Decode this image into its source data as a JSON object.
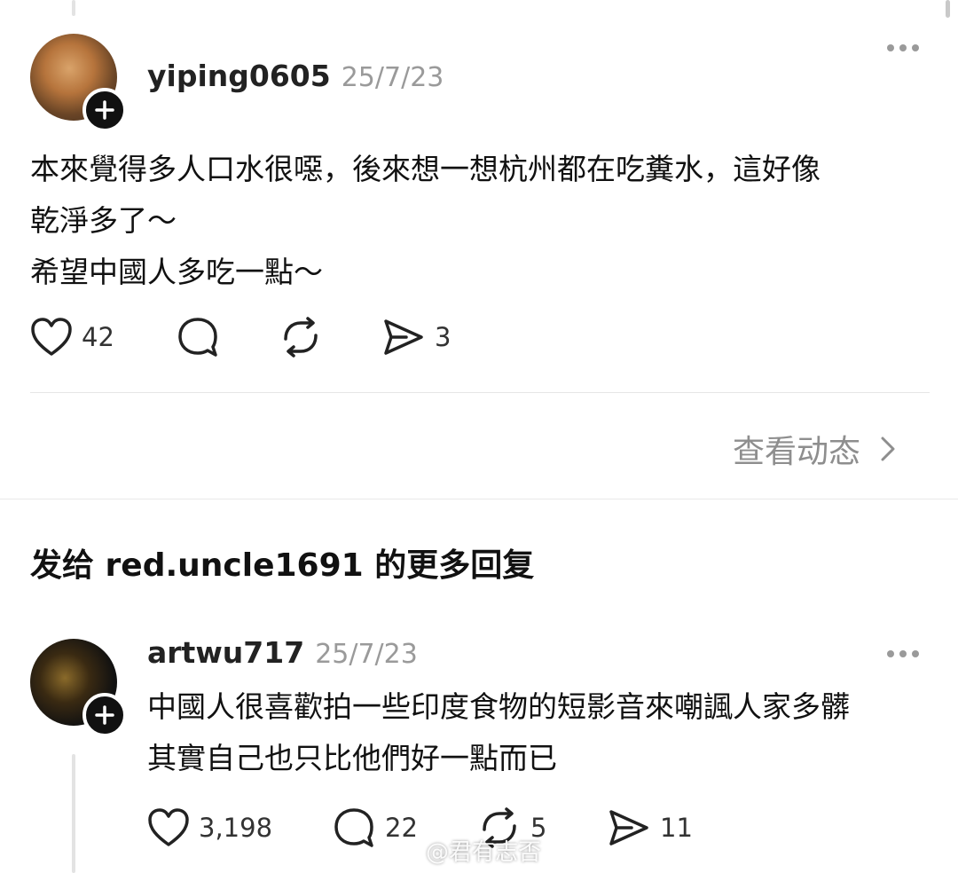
{
  "post": {
    "username": "yiping0605",
    "date": "25/7/23",
    "lines": [
      "本來覺得多人口水很噁，後來想一想杭州都在吃糞水，這好像",
      "乾淨多了～",
      "希望中國人多吃一點～"
    ],
    "likes": "42",
    "reposts": "",
    "shares": "3"
  },
  "view_activity": "查看动态",
  "section_title": "发给 red.uncle1691 的更多回复",
  "reply": {
    "username": "artwu717",
    "date": "25/7/23",
    "lines": [
      "中國人很喜歡拍一些印度食物的短影音來嘲諷人家多髒",
      "其實自己也只比他們好一點而已"
    ],
    "likes": "3,198",
    "comments": "22",
    "reposts": "5",
    "shares": "11"
  },
  "watermark": "@君有志否",
  "icons": [
    "more-icon",
    "heart-icon",
    "comment-icon",
    "repost-icon",
    "share-icon",
    "chevron-right-icon",
    "plus-icon"
  ]
}
